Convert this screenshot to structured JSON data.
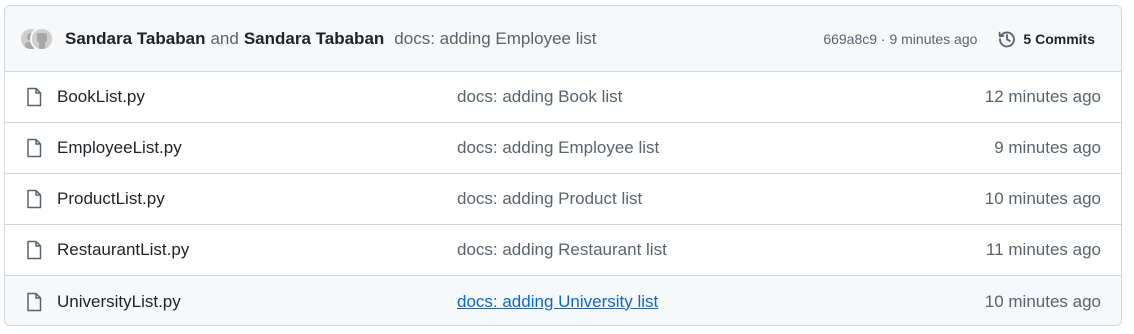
{
  "latest_commit": {
    "author_1": "Sandara Tababan",
    "conjunction": "and",
    "author_2": "Sandara Tababan",
    "message": "docs: adding Employee list",
    "meta": "669a8c9 · 9 minutes ago",
    "commits_label": "5 Commits"
  },
  "files": [
    {
      "name": "BookList.py",
      "message": "docs: adding Book list",
      "time": "12 minutes ago"
    },
    {
      "name": "EmployeeList.py",
      "message": "docs: adding Employee list",
      "time": "9 minutes ago"
    },
    {
      "name": "ProductList.py",
      "message": "docs: adding Product list",
      "time": "10 minutes ago"
    },
    {
      "name": "RestaurantList.py",
      "message": "docs: adding Restaurant list",
      "time": "11 minutes ago"
    },
    {
      "name": "UniversityList.py",
      "message": "docs: adding University list",
      "time": "10 minutes ago"
    }
  ],
  "icons": {
    "avatar": "avatar-icon",
    "history": "history-icon",
    "file": "file-icon"
  },
  "colors": {
    "header_bg": "#f6f8fa",
    "border": "#d0d7de",
    "link": "#0969da",
    "muted": "#59636e"
  }
}
